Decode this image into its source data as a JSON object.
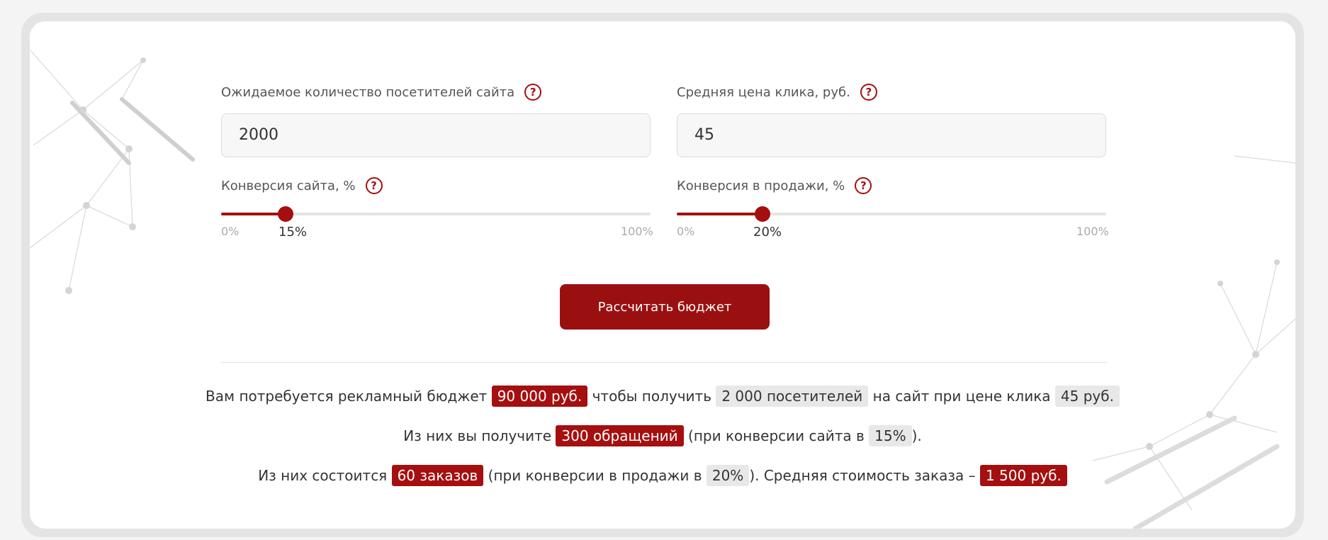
{
  "fields": {
    "visitors": {
      "label": "Ожидаемое количество посетителей сайта",
      "value": "2000"
    },
    "click_price": {
      "label": "Средняя цена клика, руб.",
      "value": "45"
    }
  },
  "sliders": {
    "site_conversion": {
      "label": "Конверсия сайта, %",
      "min_label": "0%",
      "max_label": "100%",
      "value_label": "15%",
      "value_percent": 15
    },
    "sales_conversion": {
      "label": "Конверсия в продажи, %",
      "min_label": "0%",
      "max_label": "100%",
      "value_label": "20%",
      "value_percent": 20
    }
  },
  "help_icon": "?",
  "button": {
    "label": "Рассчитать бюджет"
  },
  "result": {
    "line1": {
      "t1": "Вам потребуется рекламный бюджет",
      "budget": "90 000 руб.",
      "t2": "чтобы получить",
      "visitors": "2 000 посетителей",
      "t3": "на сайт при цене клика",
      "price": "45 руб."
    },
    "line2": {
      "t1": "Из них вы получите",
      "requests": "300 обращений",
      "t2": "(при конверсии сайта в",
      "conv": "15%",
      "t3": ")."
    },
    "line3": {
      "t1": "Из них состоится",
      "orders": "60 заказов",
      "t2": "(при конверсии в продажи в",
      "conv": "20%",
      "t3": "). Средняя стоимость заказа –",
      "avg": "1 500 руб."
    }
  },
  "colors": {
    "accent": "#a50f0f",
    "button": "#9a1010"
  }
}
